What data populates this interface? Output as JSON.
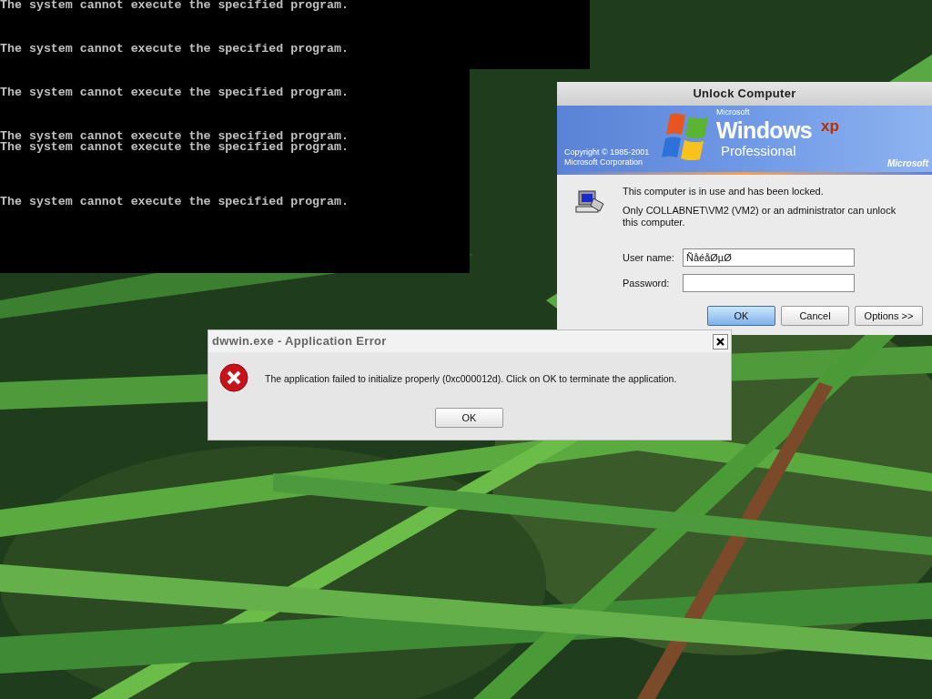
{
  "console": {
    "lines": [
      "The system cannot execute the specified program.",
      "The system cannot execute the specified program.",
      "The system cannot execute the specified program.",
      "The system cannot execute the specified program.",
      "The system cannot execute the specified program.",
      "The system cannot execute the specified program."
    ]
  },
  "unlock_dialog": {
    "title": "Unlock Computer",
    "banner": {
      "brand_small": "Microsoft",
      "brand": "Windows",
      "brand_suffix": "xp",
      "edition": "Professional",
      "copyright": [
        "Copyright © 1985-2001",
        "Microsoft Corporation"
      ],
      "corner": "Microsoft"
    },
    "messages": [
      "This computer is in use and has been locked.",
      "Only COLLABNET\\VM2 (VM2) or an administrator can unlock this computer."
    ],
    "fields": [
      {
        "label": "User name:",
        "value": "ÑåéåØµØ"
      },
      {
        "label": "Password:"
      }
    ],
    "buttons": [
      {
        "label": "OK",
        "default": true
      },
      {
        "label": "Cancel",
        "default": false
      },
      {
        "label": "Options >>",
        "default": false
      }
    ]
  },
  "error_dialog": {
    "title": "dwwin.exe - Application Error",
    "message": "The application failed to initialize properly (0xc000012d). Click on OK to terminate the application.",
    "buttons": [
      {
        "label": "OK",
        "default": false
      }
    ]
  }
}
